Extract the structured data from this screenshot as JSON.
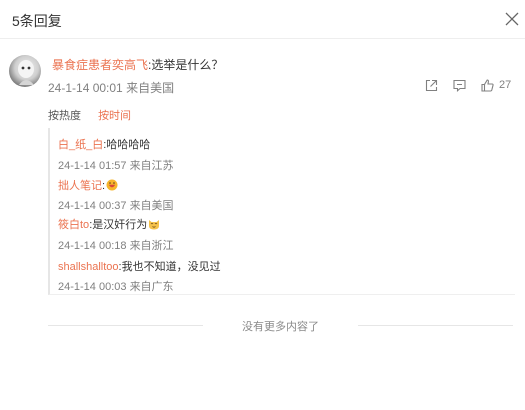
{
  "header": {
    "title": "5条回复"
  },
  "icons": {
    "close": "close-icon",
    "share": "share-icon",
    "comment": "comment-icon",
    "like": "thumbs-up-icon"
  },
  "main_comment": {
    "user": "暴食症患者奕高飞",
    "content": ":选举是什么？",
    "time": "24-1-14 00:01",
    "location": "来自美国",
    "like_count": "27"
  },
  "sort": {
    "hot_label": "按热度",
    "time_label": "按时间",
    "active": "time"
  },
  "replies": [
    {
      "user": "白_纸_白",
      "content": ":哈哈哈哈",
      "emoji": "",
      "time": "24-1-14 01:57",
      "location": "来自江苏"
    },
    {
      "user": "拙人笔记",
      "content": ":",
      "emoji": "grinning-face",
      "time": "24-1-14 00:37",
      "location": "来自美国"
    },
    {
      "user": "筱白to",
      "content": ":是汉奸行为",
      "emoji": "cat-face",
      "time": "24-1-14 00:18",
      "location": "来自浙江"
    },
    {
      "user": "shallshalltoo",
      "content": ":我也不知道，没见过",
      "emoji": "",
      "time": "24-1-14 00:03",
      "location": "来自广东"
    }
  ],
  "footer": {
    "text": "没有更多内容了"
  },
  "colors": {
    "accent": "#eb7350",
    "text": "#333333",
    "muted": "#808080",
    "divider": "#eeeeee"
  }
}
